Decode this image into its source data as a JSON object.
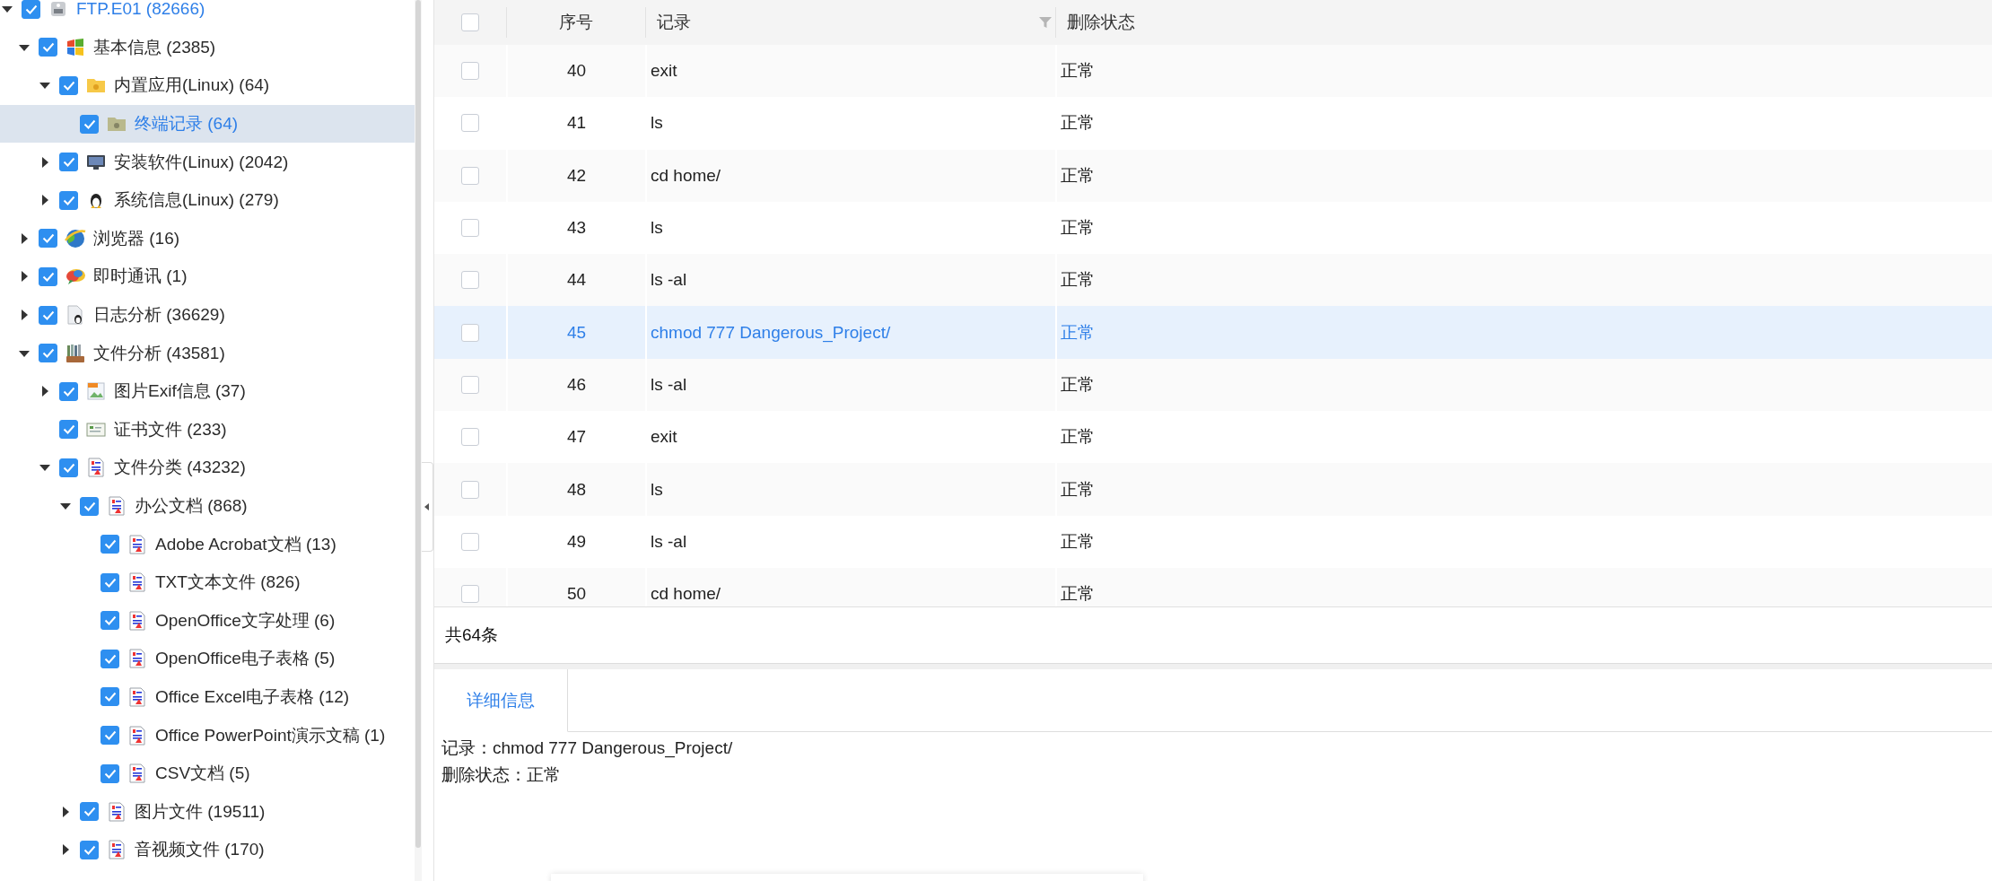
{
  "tree": [
    {
      "label": "FTP.E01 (82666)",
      "kind": "drive",
      "checked": true,
      "expanded": true,
      "selected": false,
      "current": true,
      "children": [
        {
          "label": "基本信息 (2385)",
          "kind": "windows",
          "checked": true,
          "expanded": true,
          "selected": false,
          "children": [
            {
              "label": "内置应用(Linux) (64)",
              "kind": "folder",
              "checked": true,
              "expanded": true,
              "selected": false,
              "children": [
                {
                  "label": "终端记录 (64)",
                  "kind": "folder-gray",
                  "checked": true,
                  "selected": true
                }
              ]
            },
            {
              "label": "安装软件(Linux) (2042)",
              "kind": "monitor",
              "checked": true,
              "expanded": false,
              "selected": false
            },
            {
              "label": "系统信息(Linux) (279)",
              "kind": "penguin",
              "checked": true,
              "expanded": false,
              "selected": false
            }
          ]
        },
        {
          "label": "浏览器 (16)",
          "kind": "globe",
          "checked": true,
          "expanded": false,
          "selected": false
        },
        {
          "label": "即时通讯 (1)",
          "kind": "chat",
          "checked": true,
          "expanded": false,
          "selected": false
        },
        {
          "label": "日志分析 (36629)",
          "kind": "log",
          "checked": true,
          "expanded": false,
          "selected": false
        },
        {
          "label": "文件分析 (43581)",
          "kind": "cabinet",
          "checked": true,
          "expanded": true,
          "selected": false,
          "children": [
            {
              "label": "图片Exif信息 (37)",
              "kind": "image",
              "checked": true,
              "expanded": false,
              "selected": false
            },
            {
              "label": "证书文件 (233)",
              "kind": "certificate",
              "checked": true,
              "selected": false
            },
            {
              "label": "文件分类 (43232)",
              "kind": "document",
              "checked": true,
              "expanded": true,
              "selected": false,
              "children": [
                {
                  "label": "办公文档 (868)",
                  "kind": "document",
                  "checked": true,
                  "expanded": true,
                  "selected": false,
                  "children": [
                    {
                      "label": "Adobe Acrobat文档 (13)",
                      "kind": "document",
                      "checked": true,
                      "selected": false
                    },
                    {
                      "label": "TXT文本文件 (826)",
                      "kind": "document",
                      "checked": true,
                      "selected": false
                    },
                    {
                      "label": "OpenOffice文字处理 (6)",
                      "kind": "document",
                      "checked": true,
                      "selected": false
                    },
                    {
                      "label": "OpenOffice电子表格 (5)",
                      "kind": "document",
                      "checked": true,
                      "selected": false
                    },
                    {
                      "label": "Office Excel电子表格 (12)",
                      "kind": "document",
                      "checked": true,
                      "selected": false
                    },
                    {
                      "label": "Office PowerPoint演示文稿 (1)",
                      "kind": "document",
                      "checked": true,
                      "selected": false
                    },
                    {
                      "label": "CSV文档 (5)",
                      "kind": "document",
                      "checked": true,
                      "selected": false
                    }
                  ]
                },
                {
                  "label": "图片文件 (19511)",
                  "kind": "document",
                  "checked": true,
                  "expanded": false,
                  "selected": false
                },
                {
                  "label": "音视频文件 (170)",
                  "kind": "document",
                  "checked": true,
                  "expanded": false,
                  "selected": false
                }
              ]
            }
          ]
        }
      ]
    }
  ],
  "table": {
    "header_checked": false,
    "columns": [
      "序号",
      "记录",
      "删除状态"
    ],
    "rows": [
      {
        "cells": [
          "40",
          "exit",
          "正常"
        ],
        "checked": false,
        "selected": false
      },
      {
        "cells": [
          "41",
          "ls",
          "正常"
        ],
        "checked": false,
        "selected": false
      },
      {
        "cells": [
          "42",
          "cd home/",
          "正常"
        ],
        "checked": false,
        "selected": false
      },
      {
        "cells": [
          "43",
          "ls",
          "正常"
        ],
        "checked": false,
        "selected": false
      },
      {
        "cells": [
          "44",
          "ls -al",
          "正常"
        ],
        "checked": false,
        "selected": false
      },
      {
        "cells": [
          "45",
          "chmod 777 Dangerous_Project/",
          "正常"
        ],
        "checked": false,
        "selected": true
      },
      {
        "cells": [
          "46",
          "ls -al",
          "正常"
        ],
        "checked": false,
        "selected": false
      },
      {
        "cells": [
          "47",
          "exit",
          "正常"
        ],
        "checked": false,
        "selected": false
      },
      {
        "cells": [
          "48",
          "ls",
          "正常"
        ],
        "checked": false,
        "selected": false
      },
      {
        "cells": [
          "49",
          "ls -al",
          "正常"
        ],
        "checked": false,
        "selected": false
      },
      {
        "cells": [
          "50",
          "cd home/",
          "正常"
        ],
        "checked": false,
        "selected": false
      }
    ],
    "total": "共64条"
  },
  "detail": {
    "tabs": [
      {
        "label": "详细信息",
        "selected": true
      }
    ],
    "lines": [
      "记录：chmod 777 Dangerous_Project/",
      "删除状态：正常"
    ]
  }
}
